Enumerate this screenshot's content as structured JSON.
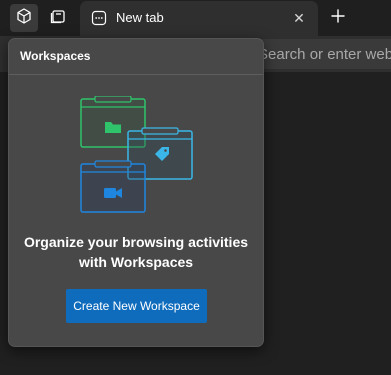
{
  "tabstrip": {
    "workspaces_icon": "workspaces-cube-icon",
    "tab_actions_icon": "tab-actions-icon",
    "tab": {
      "title": "New tab",
      "favicon": "new-tab-grid-icon",
      "close_icon": "close-icon",
      "close_glyph": "✕"
    },
    "new_tab_icon": "plus-icon"
  },
  "toolbar": {
    "address_text": "Search or enter web address"
  },
  "flyout": {
    "title": "Workspaces",
    "heading_line1": "Organize your browsing activities",
    "heading_line2": "with Workspaces",
    "button_label": "Create New Workspace",
    "illustration_icons": [
      "folder-icon",
      "tag-icon",
      "video-icon"
    ]
  },
  "colors": {
    "accent": "#0f6cbd",
    "green": "#2fc46b",
    "cyan": "#3ab7e8",
    "blue": "#1f86e0",
    "flyout_bg": "#484848"
  }
}
